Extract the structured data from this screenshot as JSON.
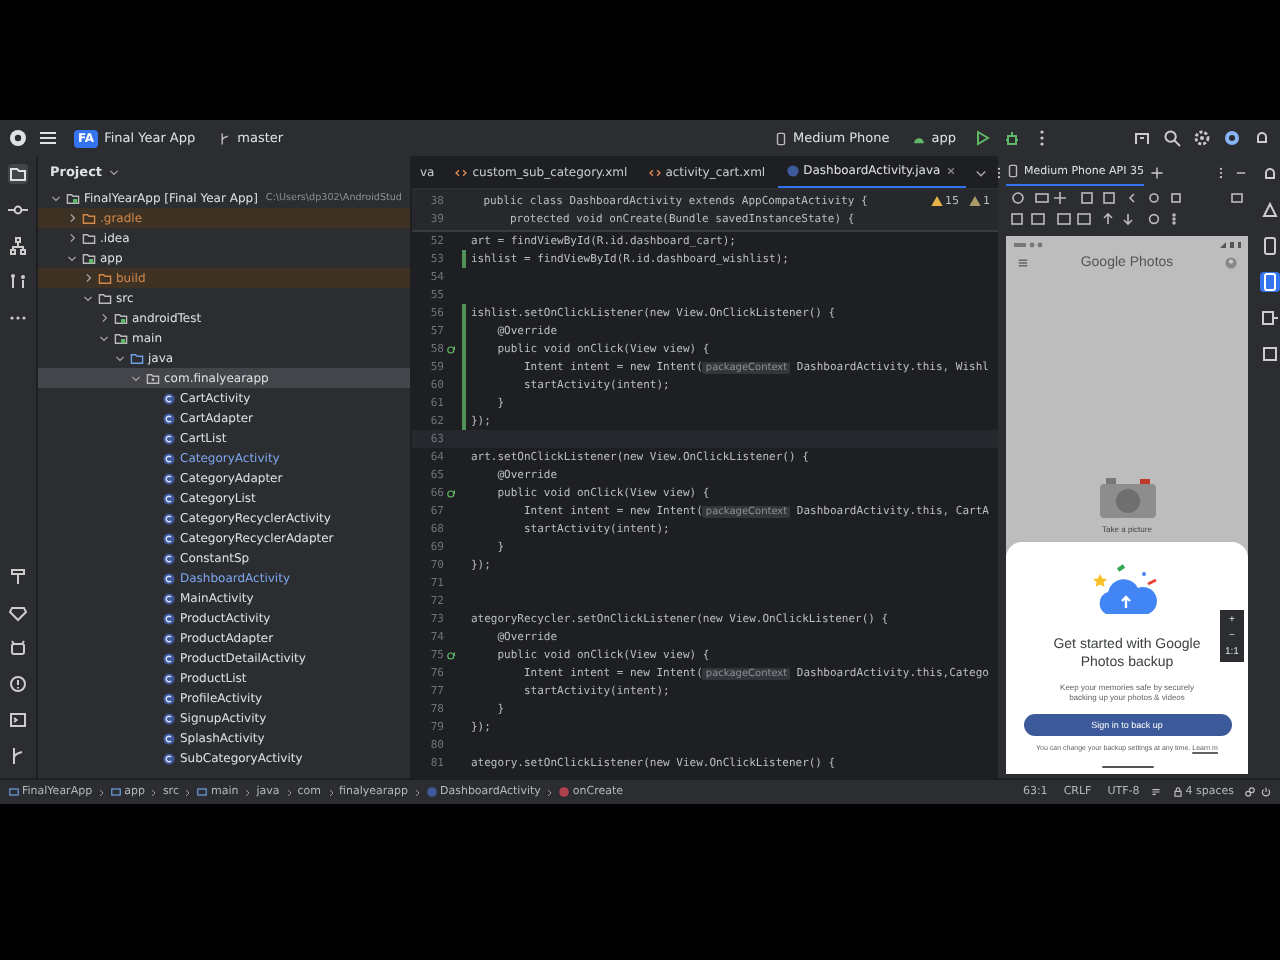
{
  "toolbar": {
    "project_badge": "FA",
    "project": "Final Year App",
    "branch": "master",
    "device": "Medium Phone",
    "run_config": "app"
  },
  "project_panel": {
    "title": "Project",
    "tree": [
      {
        "label": "FinalYearApp [Final Year App]",
        "path": "C:\\Users\\dp302\\AndroidStud",
        "kind": "module",
        "expanded": true,
        "excluded": false,
        "selected": false,
        "children": [
          {
            "label": ".gradle",
            "kind": "folder",
            "expanded": false,
            "excluded": true,
            "selected": false
          },
          {
            "label": ".idea",
            "kind": "folder",
            "expanded": false,
            "excluded": false,
            "selected": false
          },
          {
            "label": "app",
            "kind": "module",
            "expanded": true,
            "excluded": false,
            "selected": false,
            "children": [
              {
                "label": "build",
                "kind": "folder",
                "expanded": false,
                "excluded": true,
                "selected": false
              },
              {
                "label": "src",
                "kind": "folder",
                "expanded": true,
                "excluded": false,
                "selected": false,
                "children": [
                  {
                    "label": "androidTest",
                    "kind": "module",
                    "expanded": false,
                    "excluded": false,
                    "selected": false
                  },
                  {
                    "label": "main",
                    "kind": "module",
                    "expanded": true,
                    "excluded": false,
                    "selected": false,
                    "children": [
                      {
                        "label": "java",
                        "kind": "source",
                        "expanded": true,
                        "excluded": false,
                        "selected": false,
                        "children": [
                          {
                            "label": "com.finalyearapp",
                            "kind": "package",
                            "expanded": true,
                            "excluded": false,
                            "selected": true,
                            "children": [
                              {
                                "label": "CartActivity",
                                "kind": "class",
                                "modified": false,
                                "selected": false
                              },
                              {
                                "label": "CartAdapter",
                                "kind": "class",
                                "modified": false,
                                "selected": false
                              },
                              {
                                "label": "CartList",
                                "kind": "class",
                                "modified": false,
                                "selected": false
                              },
                              {
                                "label": "CategoryActivity",
                                "kind": "class",
                                "modified": true,
                                "selected": false
                              },
                              {
                                "label": "CategoryAdapter",
                                "kind": "class",
                                "modified": false,
                                "selected": false
                              },
                              {
                                "label": "CategoryList",
                                "kind": "class",
                                "modified": false,
                                "selected": false
                              },
                              {
                                "label": "CategoryRecyclerActivity",
                                "kind": "class",
                                "modified": false,
                                "selected": false
                              },
                              {
                                "label": "CategoryRecyclerAdapter",
                                "kind": "class",
                                "modified": false,
                                "selected": false
                              },
                              {
                                "label": "ConstantSp",
                                "kind": "class",
                                "modified": false,
                                "selected": false
                              },
                              {
                                "label": "DashboardActivity",
                                "kind": "class",
                                "modified": true,
                                "selected": false
                              },
                              {
                                "label": "MainActivity",
                                "kind": "class",
                                "modified": false,
                                "selected": false
                              },
                              {
                                "label": "ProductActivity",
                                "kind": "class",
                                "modified": false,
                                "selected": false
                              },
                              {
                                "label": "ProductAdapter",
                                "kind": "class",
                                "modified": false,
                                "selected": false
                              },
                              {
                                "label": "ProductDetailActivity",
                                "kind": "class",
                                "modified": false,
                                "selected": false
                              },
                              {
                                "label": "ProductList",
                                "kind": "class",
                                "modified": false,
                                "selected": false
                              },
                              {
                                "label": "ProfileActivity",
                                "kind": "class",
                                "modified": false,
                                "selected": false
                              },
                              {
                                "label": "SignupActivity",
                                "kind": "class",
                                "modified": false,
                                "selected": false
                              },
                              {
                                "label": "SplashActivity",
                                "kind": "class",
                                "modified": false,
                                "selected": false
                              },
                              {
                                "label": "SubCategoryActivity",
                                "kind": "class",
                                "modified": false,
                                "selected": false
                              }
                            ]
                          }
                        ]
                      }
                    ]
                  }
                ]
              }
            ]
          }
        ]
      }
    ]
  },
  "editor": {
    "tabs": [
      {
        "label": "va",
        "kind": "java",
        "selected": false
      },
      {
        "label": "custom_sub_category.xml",
        "kind": "xml",
        "selected": false
      },
      {
        "label": "activity_cart.xml",
        "kind": "xml",
        "selected": false
      },
      {
        "label": "DashboardActivity.java",
        "kind": "java",
        "selected": true
      }
    ],
    "warnings": "15",
    "weak_warnings": "1",
    "sticky_lines": [
      {
        "number": "38",
        "code": "    public class DashboardActivity extends AppCompatActivity {"
      },
      {
        "number": "39",
        "code": "        protected void onCreate(Bundle savedInstanceState) {"
      }
    ],
    "lines": [
      {
        "number": "52",
        "kind": "plain",
        "changed": false,
        "code": "art = findViewById(R.id.dashboard_cart);"
      },
      {
        "number": "53",
        "kind": "plain",
        "changed": true,
        "code": "ishlist = findViewById(R.id.dashboard_wishlist);"
      },
      {
        "number": "54",
        "kind": "plain",
        "changed": false
      },
      {
        "number": "55",
        "kind": "plain",
        "changed": false
      },
      {
        "number": "56",
        "kind": "plain",
        "changed": true,
        "code": "ishlist.setOnClickListener(new View.OnClickListener() {"
      },
      {
        "number": "57",
        "kind": "plain",
        "changed": true,
        "code": "    @Override"
      },
      {
        "number": "58",
        "kind": "override",
        "changed": true,
        "code": "    public void onClick(View view) {"
      },
      {
        "number": "59",
        "kind": "plain",
        "changed": true,
        "code": "        Intent intent = new Intent(",
        "hint": "packageContext",
        "rest": " DashboardActivity.this, Wishl"
      },
      {
        "number": "60",
        "kind": "plain",
        "changed": true,
        "code": "        startActivity(intent);"
      },
      {
        "number": "61",
        "kind": "plain",
        "changed": true,
        "code": "    }"
      },
      {
        "number": "62",
        "kind": "plain",
        "changed": true,
        "code": "});"
      },
      {
        "number": "63",
        "kind": "caret",
        "changed": false
      },
      {
        "number": "64",
        "kind": "plain",
        "changed": false,
        "code": "art.setOnClickListener(new View.OnClickListener() {"
      },
      {
        "number": "65",
        "kind": "plain",
        "changed": false,
        "code": "    @Override"
      },
      {
        "number": "66",
        "kind": "override",
        "changed": false,
        "code": "    public void onClick(View view) {"
      },
      {
        "number": "67",
        "kind": "plain",
        "changed": false,
        "code": "        Intent intent = new Intent(",
        "hint": "packageContext",
        "rest": " DashboardActivity.this, CartA"
      },
      {
        "number": "68",
        "kind": "plain",
        "changed": false,
        "code": "        startActivity(intent);"
      },
      {
        "number": "69",
        "kind": "plain",
        "changed": false,
        "code": "    }"
      },
      {
        "number": "70",
        "kind": "plain",
        "changed": false,
        "code": "});"
      },
      {
        "number": "71",
        "kind": "plain",
        "changed": false
      },
      {
        "number": "72",
        "kind": "plain",
        "changed": false
      },
      {
        "number": "73",
        "kind": "plain",
        "changed": false,
        "code": "ategoryRecycler.setOnClickListener(new View.OnClickListener() {"
      },
      {
        "number": "74",
        "kind": "plain",
        "changed": false,
        "code": "    @Override"
      },
      {
        "number": "75",
        "kind": "override",
        "changed": false,
        "code": "    public void onClick(View view) {"
      },
      {
        "number": "76",
        "kind": "plain",
        "changed": false,
        "code": "        Intent intent = new Intent(",
        "hint": "packageContext",
        "rest": " DashboardActivity.this,Catego"
      },
      {
        "number": "77",
        "kind": "plain",
        "changed": false,
        "code": "        startActivity(intent);"
      },
      {
        "number": "78",
        "kind": "plain",
        "changed": false,
        "code": "    }"
      },
      {
        "number": "79",
        "kind": "plain",
        "changed": false,
        "code": "});"
      },
      {
        "number": "80",
        "kind": "plain",
        "changed": false
      },
      {
        "number": "81",
        "kind": "plain",
        "changed": false,
        "code": "ategory.setOnClickListener(new View.OnClickListener() {"
      }
    ]
  },
  "emulator": {
    "tab": "Medium Phone API 35",
    "app_title": "Google Photos",
    "camera_caption": "Take a picture",
    "sheet_title": "Get started with Google Photos backup",
    "sheet_body": "Keep your memories safe by securely backing up your photos & videos",
    "sheet_button": "Sign in to back up",
    "sheet_note": "You can change your backup settings at any time.",
    "note_link": "Learn m",
    "zoom_in": "+",
    "zoom_out": "−",
    "zoom_reset": "1:1"
  },
  "breadcrumbs": [
    {
      "label": "FinalYearApp",
      "kind": "module"
    },
    {
      "label": "app",
      "kind": "module"
    },
    {
      "label": "src",
      "kind": "folder"
    },
    {
      "label": "main",
      "kind": "module"
    },
    {
      "label": "java",
      "kind": "folder"
    },
    {
      "label": "com",
      "kind": "folder"
    },
    {
      "label": "finalyearapp",
      "kind": "folder"
    },
    {
      "label": "DashboardActivity",
      "kind": "class"
    },
    {
      "label": "onCreate",
      "kind": "method"
    }
  ],
  "status": {
    "position": "63:1",
    "line_separator": "CRLF",
    "encoding": "UTF-8",
    "indent": "4 spaces"
  }
}
